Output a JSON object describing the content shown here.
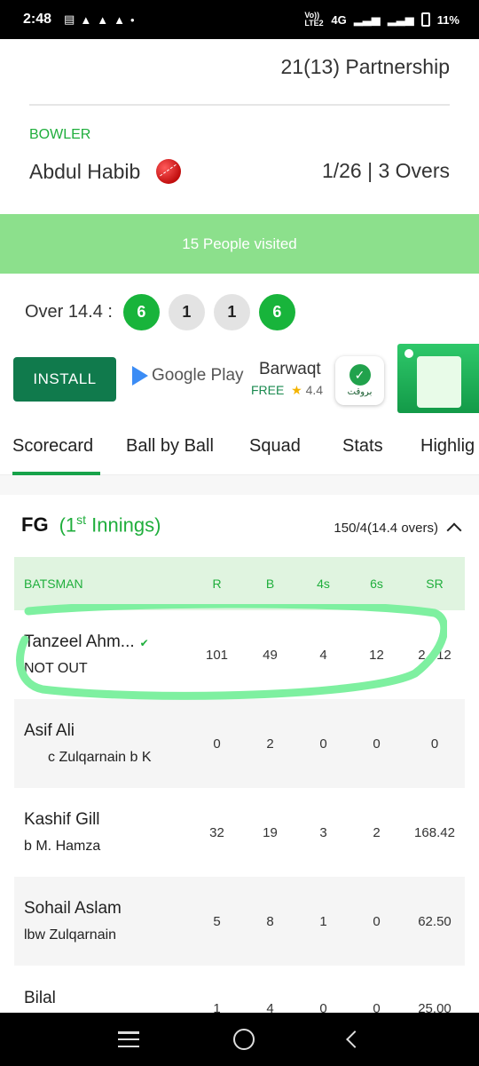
{
  "status_bar": {
    "time": "2:48",
    "notification_icons": [
      "news-icon",
      "snapchat-icon",
      "snapchat-icon",
      "snapchat-icon",
      "dot-icon"
    ],
    "network": "4G",
    "volte": "Vo)) LTE2",
    "battery": "11%"
  },
  "partnership": {
    "text": "21(13) Partnership"
  },
  "bowler": {
    "label": "BOWLER",
    "name": "Abdul Habib",
    "figures": "1/26 | 3 Overs"
  },
  "visited": {
    "text": "15 People visited"
  },
  "over": {
    "label": "Over 14.4 :",
    "balls": [
      {
        "value": "6",
        "kind": "six"
      },
      {
        "value": "1",
        "kind": "run"
      },
      {
        "value": "1",
        "kind": "run"
      },
      {
        "value": "6",
        "kind": "six"
      }
    ]
  },
  "ad": {
    "install_label": "INSTALL",
    "store_label": "Google Play",
    "app_name": "Barwaqt",
    "free_label": "FREE",
    "rating": "4.4",
    "logo_text": "بروقت"
  },
  "tabs": [
    "Scorecard",
    "Ball by Ball",
    "Squad",
    "Stats",
    "Highlig"
  ],
  "active_tab": "Scorecard",
  "innings": {
    "team": "FG",
    "open": "(1",
    "sup": "st",
    "close": " Innings)",
    "score": "150/4(14.4 overs)"
  },
  "table": {
    "headers": {
      "batsman": "BATSMAN",
      "r": "R",
      "b": "B",
      "fours": "4s",
      "sixes": "6s",
      "sr": "SR"
    },
    "rows": [
      {
        "name": "Tanzeel Ahm...",
        "striker": "✔",
        "dismissal": "NOT OUT",
        "r": "101",
        "b": "49",
        "fours": "4",
        "sixes": "12",
        "sr": "2  .12"
      },
      {
        "name": "Asif Ali",
        "striker": "",
        "dismissal": "c Zulqarnain b K",
        "r": "0",
        "b": "2",
        "fours": "0",
        "sixes": "0",
        "sr": "0"
      },
      {
        "name": "Kashif Gill",
        "striker": "",
        "dismissal": "b M. Hamza",
        "r": "32",
        "b": "19",
        "fours": "3",
        "sixes": "2",
        "sr": "168.42"
      },
      {
        "name": "Sohail Aslam",
        "striker": "",
        "dismissal": "lbw Zulqarnain",
        "r": "5",
        "b": "8",
        "fours": "1",
        "sixes": "0",
        "sr": "62.50"
      },
      {
        "name": "Bilal",
        "striker": "",
        "dismissal": "",
        "r": "1",
        "b": "4",
        "fours": "0",
        "sixes": "0",
        "sr": "25.00"
      }
    ]
  },
  "colors": {
    "accent_green": "#1fae3c",
    "visited_banner": "#8ce08c",
    "install_button": "#107a4c",
    "highlight_marker": "#7ef0a0"
  }
}
